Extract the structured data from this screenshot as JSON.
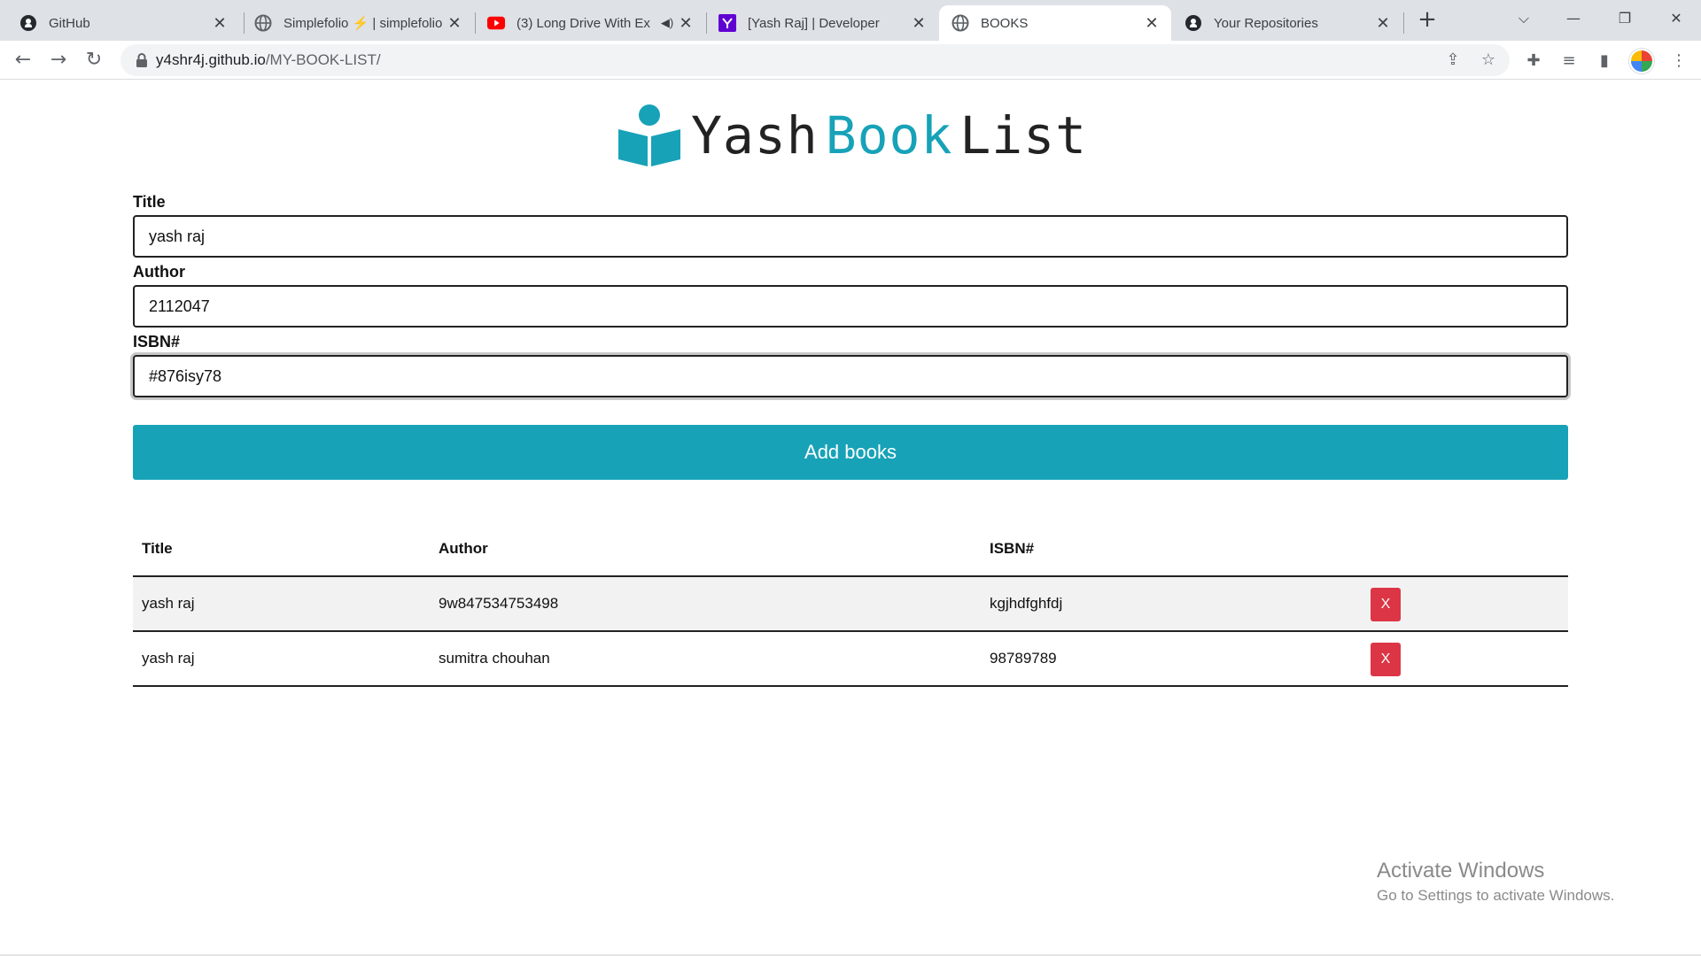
{
  "browser": {
    "tabs": [
      {
        "title": "GitHub",
        "icon": "github-icon",
        "active": false
      },
      {
        "title": "Simplefolio ⚡ | simplefolio",
        "icon": "globe-icon",
        "active": false
      },
      {
        "title": "(3) Long Drive With Ex",
        "icon": "youtube-icon",
        "active": false
      },
      {
        "title": "[Yash Raj] | Developer",
        "icon": "yahoo-icon",
        "active": false
      },
      {
        "title": "BOOKS",
        "icon": "globe-icon",
        "active": true
      },
      {
        "title": "Your Repositories",
        "icon": "github-icon",
        "active": false
      }
    ],
    "url_host": "y4shr4j.github.io",
    "url_path": "/MY-BOOK-LIST/"
  },
  "brand": {
    "word1": "Yash",
    "word2": "Book",
    "word3": "List",
    "accent_color": "#17a2b8"
  },
  "form": {
    "title_label": "Title",
    "title_value": "yash raj",
    "author_label": "Author",
    "author_value": "2112047",
    "isbn_label": "ISBN#",
    "isbn_value": "#876isy78",
    "submit_label": "Add books"
  },
  "table": {
    "headers": [
      "Title",
      "Author",
      "ISBN#"
    ],
    "rows": [
      {
        "title": "yash raj",
        "author": "9w847534753498",
        "isbn": "kgjhdfghfdj",
        "delete_label": "X"
      },
      {
        "title": "yash raj",
        "author": "sumitra chouhan",
        "isbn": "98789789",
        "delete_label": "X"
      }
    ],
    "delete_color": "#dc3545"
  },
  "watermark": {
    "line1": "Activate Windows",
    "line2": "Go to Settings to activate Windows."
  }
}
